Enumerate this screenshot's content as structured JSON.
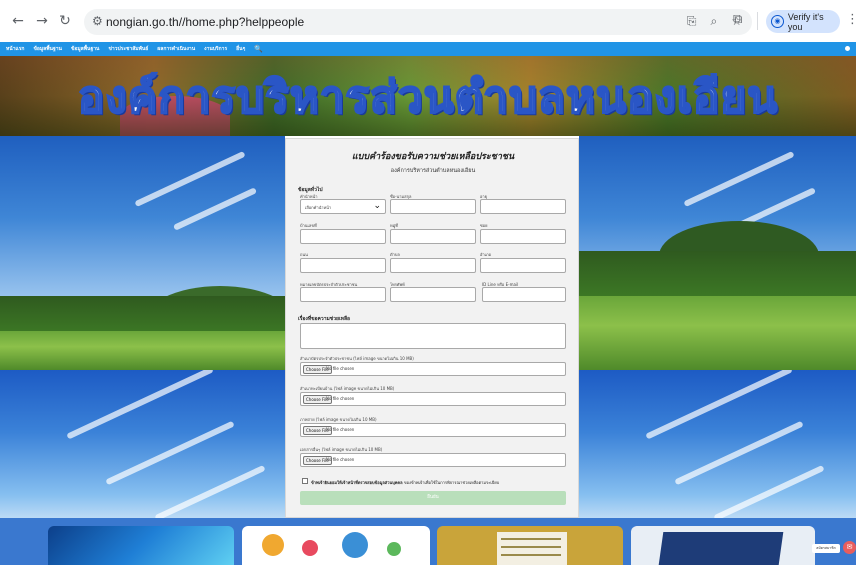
{
  "browser": {
    "url": "nongian.go.th//home.php?helppeople",
    "verify_label": "Verify it's you"
  },
  "site_nav": {
    "items": [
      "หน้าแรก",
      "ข้อมูลพื้นฐาน",
      "ข้อมูลพื้นฐาน",
      "ข่าวประชาสัมพันธ์",
      "ผลการดำเนินงาน",
      "งานบริการ",
      "อื่นๆ"
    ]
  },
  "banner": {
    "title": "องค์การบริหารส่วนตำบลหนองเอียน"
  },
  "form": {
    "title": "แบบคำร้องขอรับความช่วยเหลือประชาชน",
    "subtitle": "องค์การบริหารส่วนตำบลหนองเอียน",
    "section_info": "ข้อมูลทั่วไป",
    "label_prefix": "คำนำหน้า",
    "select_prefix_placeholder": "เลือกคำนำหน้า",
    "label_firstname": "ชื่อ-นามสกุล",
    "label_age": "อายุ",
    "label_house_no": "บ้านเลขที่",
    "label_moo": "หมู่ที่",
    "label_soi": "ซอย",
    "label_road": "ถนน",
    "label_subdistrict": "ตำบล",
    "label_district": "อำเภอ",
    "label_id_card": "หมายเลขบัตรประจำตัวประชาชน",
    "label_phone": "โทรศัพท์",
    "label_line_email": "ID Line หรือ E-mail",
    "section_details": "เรื่องที่ขอความช่วยเหลือ",
    "uploads": [
      {
        "label": "สำเนาบัตรประจำตัวประชาชน (ไฟล์ image ขนาดไม่เกิน 10 MB)",
        "button": "Choose File",
        "status": "No file chosen"
      },
      {
        "label": "สำเนาทะเบียนบ้าน (ไฟล์ image ขนาดไม่เกิน 10 MB)",
        "button": "Choose File",
        "status": "No file chosen"
      },
      {
        "label": "ภาพถ่าย (ไฟล์ image ขนาดไม่เกิน 10 MB)",
        "button": "Choose File",
        "status": "No file chosen"
      },
      {
        "label": "เอกสารอื่นๆ (ไฟล์ image ขนาดไม่เกิน 10 MB)",
        "button": "Choose File",
        "status": "No file chosen"
      }
    ],
    "consent_bold": "ข้าพเจ้ายินยอมให้เจ้าหน้าที่ตรวจสอบข้อมูลส่วนบุคคล",
    "consent_rest": "ของข้าพเจ้าเพื่อใช้ในการพิจารณาช่วยเหลือตามระเบียบ",
    "submit_label": "ยืนยัน"
  },
  "floating": {
    "admin_label": "สมัครสมาชิก",
    "chat_icon": "chat-icon"
  }
}
